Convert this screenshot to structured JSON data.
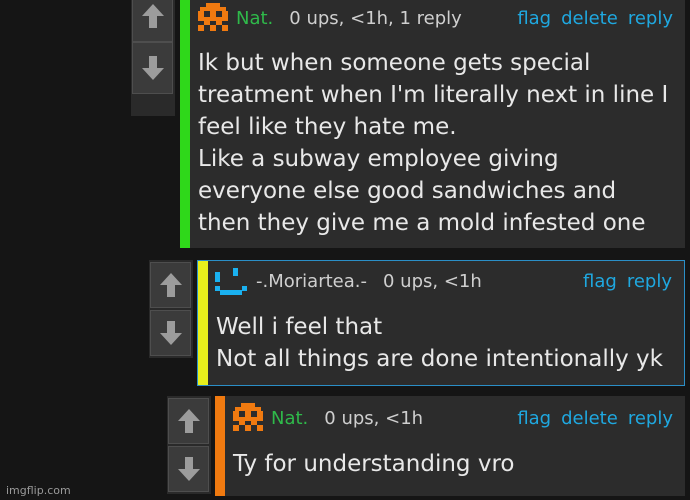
{
  "comments": [
    {
      "username": "Nat.",
      "meta": "0 ups, <1h, 1 reply",
      "actions": {
        "flag": "flag",
        "delete": "delete",
        "reply": "reply"
      },
      "lines": [
        "Ik but when someone gets special",
        "treatment when I'm literally next in line I",
        "feel like they hate me.",
        "Like a subway employee giving",
        "everyone else good sandwiches and",
        "then they give me a mold infested one"
      ],
      "bar_color": "#2fd81a",
      "username_color": "#2fb94a"
    },
    {
      "username": "-.Moriartea.-",
      "meta": "0 ups, <1h",
      "actions": {
        "flag": "flag",
        "reply": "reply"
      },
      "lines": [
        "Well i feel that",
        "Not all things are done intentionally yk"
      ],
      "bar_color": "#e7ef1c",
      "username_color": "#cfcfcf",
      "border_color": "#2b8fc7"
    },
    {
      "username": "Nat.",
      "meta": "0 ups, <1h",
      "actions": {
        "flag": "flag",
        "delete": "delete",
        "reply": "reply"
      },
      "lines": [
        "Ty for understanding vro"
      ],
      "bar_color": "#f07a10",
      "username_color": "#2fb94a"
    }
  ],
  "watermark": "imgflip.com",
  "icons": [
    "arrow-up-icon",
    "arrow-down-icon",
    "pixel-skull-avatar-icon",
    "pixel-smiley-avatar-icon"
  ]
}
